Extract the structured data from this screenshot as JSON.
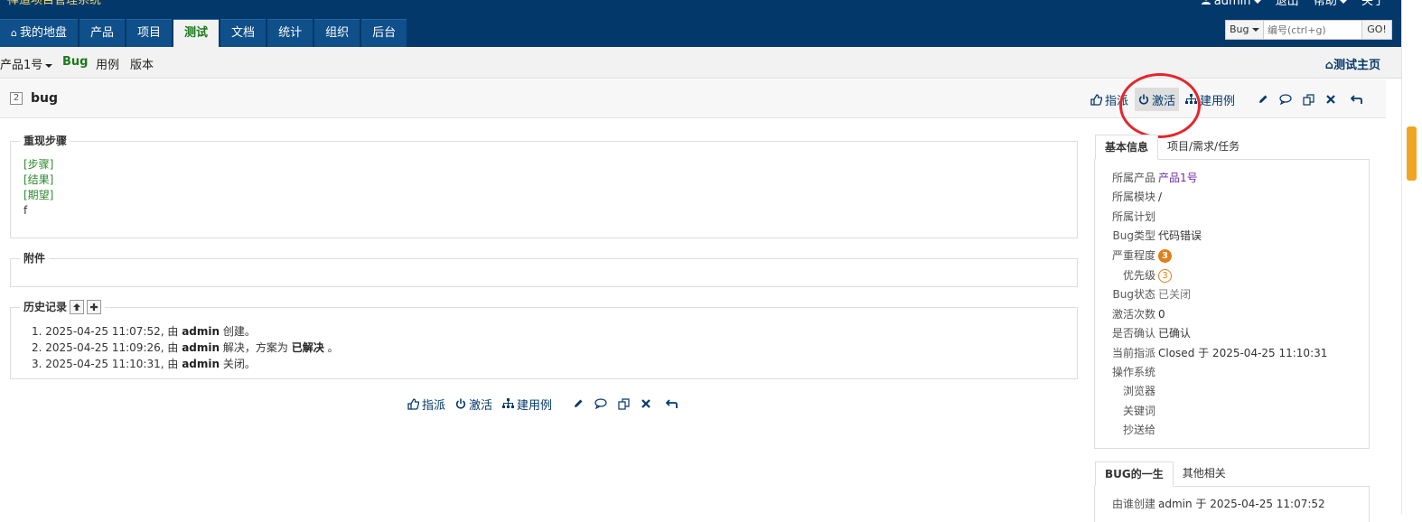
{
  "app": {
    "name": "禅道项目管理系统",
    "user": "admin",
    "logout": "退出",
    "help": "帮助",
    "about": "关于"
  },
  "mainnav": [
    {
      "label": "我的地盘",
      "icon": "home-icon"
    },
    {
      "label": "产品"
    },
    {
      "label": "项目"
    },
    {
      "label": "测试",
      "active": true
    },
    {
      "label": "文档"
    },
    {
      "label": "统计"
    },
    {
      "label": "组织"
    },
    {
      "label": "后台"
    }
  ],
  "search": {
    "type": "Bug",
    "placeholder": "编号(ctrl+g)",
    "go": "GO!"
  },
  "subnav": {
    "product": "产品1号",
    "items": [
      "Bug",
      "用例",
      "版本"
    ],
    "home": "测试主页"
  },
  "bug": {
    "id": "2",
    "title": "bug"
  },
  "actions": {
    "assign": "指派",
    "activate": "激活",
    "create_case": "建用例"
  },
  "steps": {
    "legend": "重现步骤",
    "lines": [
      "[步骤]",
      "[结果]",
      "[期望]",
      "f"
    ]
  },
  "files": {
    "legend": "附件"
  },
  "history": {
    "legend": "历史记录",
    "entries": [
      {
        "num": "1.",
        "time": "2025-04-25 11:07:52, 由",
        "actor": "admin",
        "text": "创建。"
      },
      {
        "num": "2.",
        "time": "2025-04-25 11:09:26, 由",
        "actor": "admin",
        "text": "解决，方案为",
        "bold": "已解决",
        "tail": "。"
      },
      {
        "num": "3.",
        "time": "2025-04-25 11:10:31, 由",
        "actor": "admin",
        "text": "关闭。"
      }
    ]
  },
  "side": {
    "tabs": [
      "基本信息",
      "项目/需求/任务"
    ],
    "fields": [
      {
        "label": "所属产品",
        "value": "产品1号"
      },
      {
        "label": "所属模块",
        "value": "/"
      },
      {
        "label": "所属计划",
        "value": ""
      },
      {
        "label": "Bug类型",
        "value": "代码错误"
      },
      {
        "label": "严重程度",
        "value": "3"
      },
      {
        "label": "优先级",
        "value": "3"
      },
      {
        "label": "Bug状态",
        "value": "已关闭"
      },
      {
        "label": "激活次数",
        "value": "0"
      },
      {
        "label": "是否确认",
        "value": "已确认"
      },
      {
        "label": "当前指派",
        "value": "Closed 于 2025-04-25 11:10:31"
      },
      {
        "label": "操作系统",
        "value": ""
      },
      {
        "label": "浏览器",
        "value": ""
      },
      {
        "label": "关键词",
        "value": ""
      },
      {
        "label": "抄送给",
        "value": ""
      }
    ],
    "life_tabs": [
      "BUG的一生",
      "其他相关"
    ],
    "life_fields": [
      {
        "label": "由谁创建",
        "value": "admin 于 2025-04-25 11:07:52"
      }
    ]
  },
  "colors": {
    "header": "#03386b",
    "active_green": "#1a7a1a",
    "highlight_circle": "#e3262d",
    "severity": "#e0801a"
  }
}
